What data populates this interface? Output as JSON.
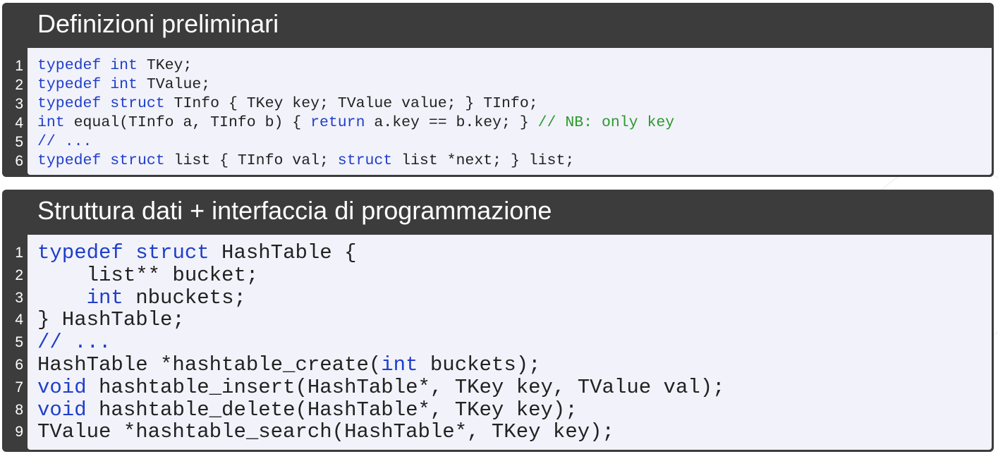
{
  "blocks": [
    {
      "title": "Definizioni preliminari",
      "line_numbers": [
        "1",
        "2",
        "3",
        "4",
        "5",
        "6"
      ],
      "lines": [
        [
          {
            "t": "typedef",
            "k": "kw"
          },
          {
            "t": " "
          },
          {
            "t": "int",
            "k": "kw"
          },
          {
            "t": " TKey;"
          }
        ],
        [
          {
            "t": "typedef",
            "k": "kw"
          },
          {
            "t": " "
          },
          {
            "t": "int",
            "k": "kw"
          },
          {
            "t": " TValue;"
          }
        ],
        [
          {
            "t": "typedef",
            "k": "kw"
          },
          {
            "t": " "
          },
          {
            "t": "struct",
            "k": "kw"
          },
          {
            "t": " TInfo { TKey key; TValue value; } TInfo;"
          }
        ],
        [
          {
            "t": "int",
            "k": "kw"
          },
          {
            "t": " equal(TInfo a, TInfo b) { "
          },
          {
            "t": "return",
            "k": "kw"
          },
          {
            "t": " a.key == b.key; } "
          },
          {
            "t": "// NB: only key",
            "k": "cm"
          }
        ],
        [
          {
            "t": "// ...",
            "k": "kw"
          }
        ],
        [
          {
            "t": "typedef",
            "k": "kw"
          },
          {
            "t": " "
          },
          {
            "t": "struct",
            "k": "kw"
          },
          {
            "t": " list { TInfo val; "
          },
          {
            "t": "struct",
            "k": "kw"
          },
          {
            "t": " list *next; } list;"
          }
        ]
      ]
    },
    {
      "title": "Struttura dati + interfaccia di programmazione",
      "line_numbers": [
        "1",
        "2",
        "3",
        "4",
        "5",
        "6",
        "7",
        "8",
        "9"
      ],
      "lines": [
        [
          {
            "t": "typedef",
            "k": "kw"
          },
          {
            "t": " "
          },
          {
            "t": "struct",
            "k": "kw"
          },
          {
            "t": " HashTable {"
          }
        ],
        [
          {
            "t": "    list** bucket;"
          }
        ],
        [
          {
            "t": "    "
          },
          {
            "t": "int",
            "k": "kw"
          },
          {
            "t": " nbuckets;"
          }
        ],
        [
          {
            "t": "} HashTable;"
          }
        ],
        [
          {
            "t": "// ...",
            "k": "kw"
          }
        ],
        [
          {
            "t": "HashTable *hashtable_create("
          },
          {
            "t": "int",
            "k": "kw"
          },
          {
            "t": " buckets);"
          }
        ],
        [
          {
            "t": "void",
            "k": "kw"
          },
          {
            "t": " hashtable_insert(HashTable*, TKey key, TValue val);"
          }
        ],
        [
          {
            "t": "void",
            "k": "kw"
          },
          {
            "t": " hashtable_delete(HashTable*, TKey key);"
          }
        ],
        [
          {
            "t": "TValue *hashtable_search(HashTable*, TKey key);"
          }
        ]
      ]
    }
  ],
  "colors": {
    "keyword": "#1f3fc8",
    "comment": "#2a9a2a",
    "header_bg": "#3c3c3c",
    "code_bg": "#f2f2fb"
  }
}
